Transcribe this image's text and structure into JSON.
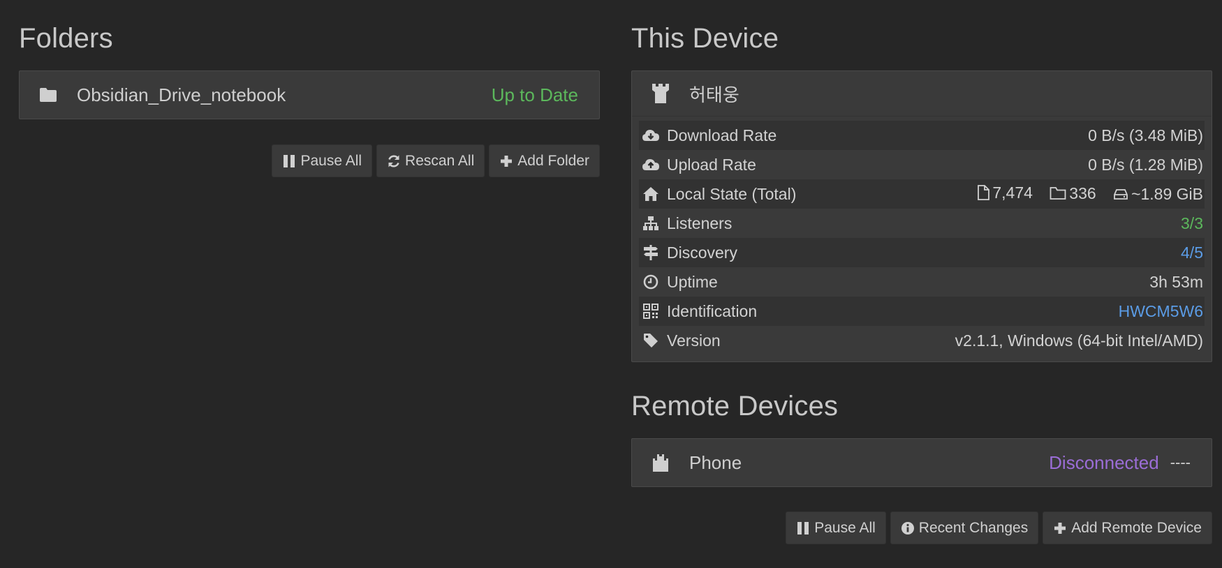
{
  "folders": {
    "title": "Folders",
    "items": [
      {
        "name": "Obsidian_Drive_notebook",
        "status": "Up to Date",
        "icon": "folder-icon"
      }
    ],
    "buttons": {
      "pause_all": "Pause All",
      "rescan_all": "Rescan All",
      "add_folder": "Add Folder"
    }
  },
  "this_device": {
    "title": "This Device",
    "name": "허태웅",
    "icon": "castle-tower-icon",
    "stats": [
      {
        "label": "Download Rate",
        "value": "0 B/s (3.48 MiB)",
        "icon": "cloud-download-icon"
      },
      {
        "label": "Upload Rate",
        "value": "0 B/s (1.28 MiB)",
        "icon": "cloud-upload-icon"
      },
      {
        "label": "Local State (Total)",
        "files": "7,474",
        "dirs": "336",
        "size": "~1.89 GiB",
        "icon": "home-icon"
      },
      {
        "label": "Listeners",
        "value": "3/3",
        "icon": "sitemap-icon"
      },
      {
        "label": "Discovery",
        "value": "4/5",
        "icon": "signpost-icon"
      },
      {
        "label": "Uptime",
        "value": "3h 53m",
        "icon": "clock-icon"
      },
      {
        "label": "Identification",
        "value": "HWCM5W6",
        "icon": "qrcode-icon"
      },
      {
        "label": "Version",
        "value": "v2.1.1, Windows (64-bit Intel/AMD)",
        "icon": "tag-icon"
      }
    ],
    "colors": {
      "green": "#5cb85c",
      "blue": "#5b9ce6"
    }
  },
  "remote_devices": {
    "title": "Remote Devices",
    "items": [
      {
        "name": "Phone",
        "status": "Disconnected",
        "extra": "----",
        "icon": "castle-icon"
      }
    ],
    "buttons": {
      "pause_all": "Pause All",
      "recent_changes": "Recent Changes",
      "add_remote_device": "Add Remote Device"
    },
    "colors": {
      "disconnected": "#9b6dd6"
    }
  }
}
